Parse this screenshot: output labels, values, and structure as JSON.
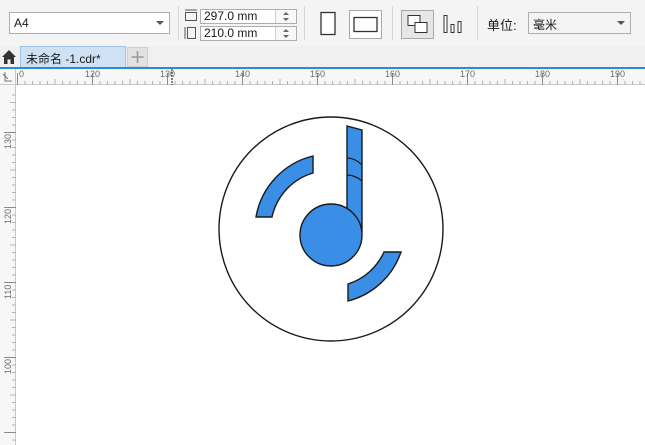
{
  "toolbar": {
    "page_size": "A4",
    "width_value": "297.0 mm",
    "height_value": "210.0 mm",
    "units_label": "单位:",
    "units_value": "毫米"
  },
  "tabs": [
    {
      "label": "未命名 -1.cdr*"
    }
  ],
  "ruler_h": {
    "labels": [
      "0",
      "120",
      "130",
      "140",
      "150",
      "160",
      "170",
      "180",
      "190"
    ]
  },
  "ruler_v": {
    "labels": [
      "130",
      "120",
      "110",
      "100"
    ]
  },
  "colors": {
    "accent": "#2d8ccc",
    "shape_fill": "#3a8ee6",
    "stroke": "#1a1a1a"
  },
  "icons": [
    "home-icon",
    "add-tab-icon",
    "portrait-icon",
    "landscape-icon",
    "all-pages-icon",
    "current-page-icon"
  ]
}
